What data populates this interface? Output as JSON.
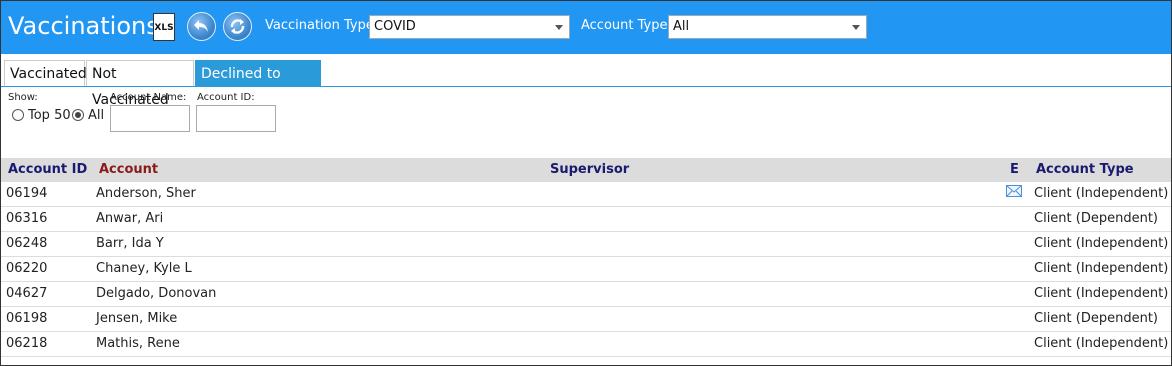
{
  "header": {
    "title": "Vaccinations",
    "xls_icon_text": "XLS",
    "vaccination_type_label": "Vaccination Type:",
    "vaccination_type_value": "COVID",
    "account_type_label": "Account Type:",
    "account_type_value": "All",
    "colors": {
      "header_bg": "#2196f3",
      "tab_active": "#2b9ad8"
    }
  },
  "tabs": [
    {
      "label": "Vaccinated",
      "active": false
    },
    {
      "label": "Not Vaccinated",
      "active": false
    },
    {
      "label": "Declined to Share",
      "active": true
    }
  ],
  "filters": {
    "show_label": "Show:",
    "top50_label": "Top 50",
    "all_label": "All",
    "selected": "All",
    "account_name_label": "Account Name:",
    "account_id_label": "Account ID:",
    "account_name_value": "",
    "account_id_value": ""
  },
  "table": {
    "columns": {
      "account_id": "Account ID",
      "account": "Account",
      "supervisor": "Supervisor",
      "e": "E",
      "account_type": "Account Type"
    },
    "rows": [
      {
        "id": "06194",
        "account": "Anderson, Sher",
        "supervisor": "",
        "email": true,
        "type": "Client (Independent)"
      },
      {
        "id": "06316",
        "account": "Anwar, Ari",
        "supervisor": "",
        "email": false,
        "type": "Client (Dependent)"
      },
      {
        "id": "06248",
        "account": "Barr, Ida Y",
        "supervisor": "",
        "email": false,
        "type": "Client (Independent)"
      },
      {
        "id": "06220",
        "account": "Chaney, Kyle L",
        "supervisor": "",
        "email": false,
        "type": "Client (Independent)"
      },
      {
        "id": "04627",
        "account": "Delgado, Donovan",
        "supervisor": "",
        "email": false,
        "type": "Client (Independent)"
      },
      {
        "id": "06198",
        "account": "Jensen, Mike",
        "supervisor": "",
        "email": false,
        "type": "Client (Dependent)"
      },
      {
        "id": "06218",
        "account": "Mathis, Rene",
        "supervisor": "",
        "email": false,
        "type": "Client (Independent)"
      }
    ]
  },
  "icons": {
    "excel": "xls-file-icon",
    "undo": "undo-icon",
    "refresh": "refresh-icon",
    "email": "envelope-icon"
  }
}
